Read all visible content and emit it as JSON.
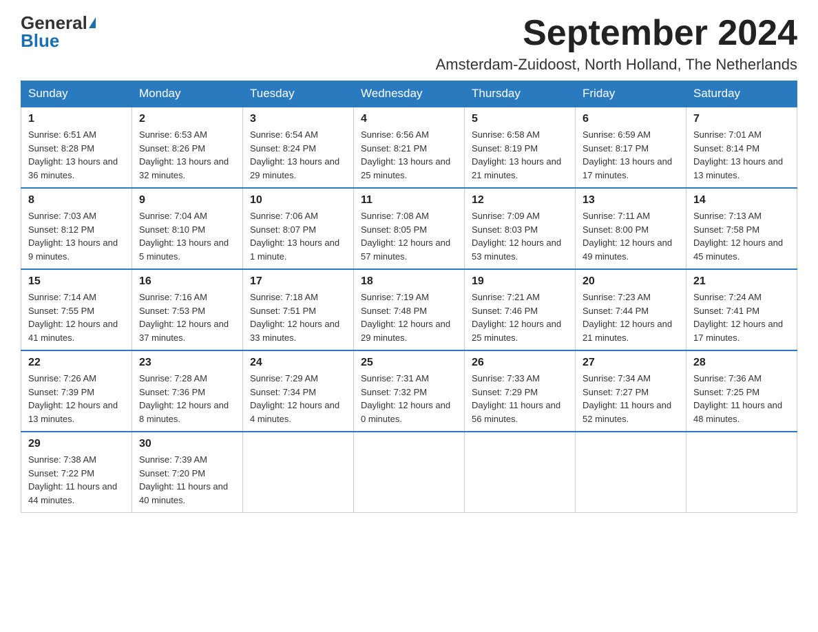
{
  "header": {
    "logo_general": "General",
    "logo_blue": "Blue",
    "month_title": "September 2024",
    "subtitle": "Amsterdam-Zuidoost, North Holland, The Netherlands"
  },
  "calendar": {
    "days_of_week": [
      "Sunday",
      "Monday",
      "Tuesday",
      "Wednesday",
      "Thursday",
      "Friday",
      "Saturday"
    ],
    "weeks": [
      [
        {
          "day": "1",
          "sunrise": "Sunrise: 6:51 AM",
          "sunset": "Sunset: 8:28 PM",
          "daylight": "Daylight: 13 hours and 36 minutes."
        },
        {
          "day": "2",
          "sunrise": "Sunrise: 6:53 AM",
          "sunset": "Sunset: 8:26 PM",
          "daylight": "Daylight: 13 hours and 32 minutes."
        },
        {
          "day": "3",
          "sunrise": "Sunrise: 6:54 AM",
          "sunset": "Sunset: 8:24 PM",
          "daylight": "Daylight: 13 hours and 29 minutes."
        },
        {
          "day": "4",
          "sunrise": "Sunrise: 6:56 AM",
          "sunset": "Sunset: 8:21 PM",
          "daylight": "Daylight: 13 hours and 25 minutes."
        },
        {
          "day": "5",
          "sunrise": "Sunrise: 6:58 AM",
          "sunset": "Sunset: 8:19 PM",
          "daylight": "Daylight: 13 hours and 21 minutes."
        },
        {
          "day": "6",
          "sunrise": "Sunrise: 6:59 AM",
          "sunset": "Sunset: 8:17 PM",
          "daylight": "Daylight: 13 hours and 17 minutes."
        },
        {
          "day": "7",
          "sunrise": "Sunrise: 7:01 AM",
          "sunset": "Sunset: 8:14 PM",
          "daylight": "Daylight: 13 hours and 13 minutes."
        }
      ],
      [
        {
          "day": "8",
          "sunrise": "Sunrise: 7:03 AM",
          "sunset": "Sunset: 8:12 PM",
          "daylight": "Daylight: 13 hours and 9 minutes."
        },
        {
          "day": "9",
          "sunrise": "Sunrise: 7:04 AM",
          "sunset": "Sunset: 8:10 PM",
          "daylight": "Daylight: 13 hours and 5 minutes."
        },
        {
          "day": "10",
          "sunrise": "Sunrise: 7:06 AM",
          "sunset": "Sunset: 8:07 PM",
          "daylight": "Daylight: 13 hours and 1 minute."
        },
        {
          "day": "11",
          "sunrise": "Sunrise: 7:08 AM",
          "sunset": "Sunset: 8:05 PM",
          "daylight": "Daylight: 12 hours and 57 minutes."
        },
        {
          "day": "12",
          "sunrise": "Sunrise: 7:09 AM",
          "sunset": "Sunset: 8:03 PM",
          "daylight": "Daylight: 12 hours and 53 minutes."
        },
        {
          "day": "13",
          "sunrise": "Sunrise: 7:11 AM",
          "sunset": "Sunset: 8:00 PM",
          "daylight": "Daylight: 12 hours and 49 minutes."
        },
        {
          "day": "14",
          "sunrise": "Sunrise: 7:13 AM",
          "sunset": "Sunset: 7:58 PM",
          "daylight": "Daylight: 12 hours and 45 minutes."
        }
      ],
      [
        {
          "day": "15",
          "sunrise": "Sunrise: 7:14 AM",
          "sunset": "Sunset: 7:55 PM",
          "daylight": "Daylight: 12 hours and 41 minutes."
        },
        {
          "day": "16",
          "sunrise": "Sunrise: 7:16 AM",
          "sunset": "Sunset: 7:53 PM",
          "daylight": "Daylight: 12 hours and 37 minutes."
        },
        {
          "day": "17",
          "sunrise": "Sunrise: 7:18 AM",
          "sunset": "Sunset: 7:51 PM",
          "daylight": "Daylight: 12 hours and 33 minutes."
        },
        {
          "day": "18",
          "sunrise": "Sunrise: 7:19 AM",
          "sunset": "Sunset: 7:48 PM",
          "daylight": "Daylight: 12 hours and 29 minutes."
        },
        {
          "day": "19",
          "sunrise": "Sunrise: 7:21 AM",
          "sunset": "Sunset: 7:46 PM",
          "daylight": "Daylight: 12 hours and 25 minutes."
        },
        {
          "day": "20",
          "sunrise": "Sunrise: 7:23 AM",
          "sunset": "Sunset: 7:44 PM",
          "daylight": "Daylight: 12 hours and 21 minutes."
        },
        {
          "day": "21",
          "sunrise": "Sunrise: 7:24 AM",
          "sunset": "Sunset: 7:41 PM",
          "daylight": "Daylight: 12 hours and 17 minutes."
        }
      ],
      [
        {
          "day": "22",
          "sunrise": "Sunrise: 7:26 AM",
          "sunset": "Sunset: 7:39 PM",
          "daylight": "Daylight: 12 hours and 13 minutes."
        },
        {
          "day": "23",
          "sunrise": "Sunrise: 7:28 AM",
          "sunset": "Sunset: 7:36 PM",
          "daylight": "Daylight: 12 hours and 8 minutes."
        },
        {
          "day": "24",
          "sunrise": "Sunrise: 7:29 AM",
          "sunset": "Sunset: 7:34 PM",
          "daylight": "Daylight: 12 hours and 4 minutes."
        },
        {
          "day": "25",
          "sunrise": "Sunrise: 7:31 AM",
          "sunset": "Sunset: 7:32 PM",
          "daylight": "Daylight: 12 hours and 0 minutes."
        },
        {
          "day": "26",
          "sunrise": "Sunrise: 7:33 AM",
          "sunset": "Sunset: 7:29 PM",
          "daylight": "Daylight: 11 hours and 56 minutes."
        },
        {
          "day": "27",
          "sunrise": "Sunrise: 7:34 AM",
          "sunset": "Sunset: 7:27 PM",
          "daylight": "Daylight: 11 hours and 52 minutes."
        },
        {
          "day": "28",
          "sunrise": "Sunrise: 7:36 AM",
          "sunset": "Sunset: 7:25 PM",
          "daylight": "Daylight: 11 hours and 48 minutes."
        }
      ],
      [
        {
          "day": "29",
          "sunrise": "Sunrise: 7:38 AM",
          "sunset": "Sunset: 7:22 PM",
          "daylight": "Daylight: 11 hours and 44 minutes."
        },
        {
          "day": "30",
          "sunrise": "Sunrise: 7:39 AM",
          "sunset": "Sunset: 7:20 PM",
          "daylight": "Daylight: 11 hours and 40 minutes."
        },
        null,
        null,
        null,
        null,
        null
      ]
    ]
  }
}
